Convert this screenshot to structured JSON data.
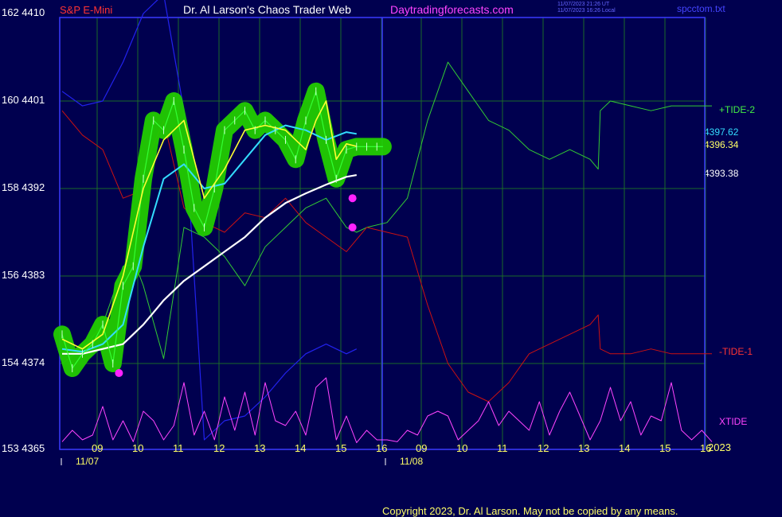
{
  "header": {
    "symbol": "S&P E-Mini",
    "title": "Dr. Al Larson's Chaos Trader Web",
    "site": "Daytradingforecasts.com",
    "file": "spcctom.txt",
    "timestamp_line1": "11/07/2023 21:26 UT",
    "timestamp_line2": "11/07/2023 16:26 Local"
  },
  "colors": {
    "background": "#00004f",
    "grid": "#1a6a2a",
    "border": "#3a3aff",
    "price_bars": "#33ff33",
    "glow": "#22cc00",
    "ma_fast": "#ffff33",
    "ma_mid": "#33ddff",
    "ma_slow": "#ffffff",
    "tide_plus": "#33cc33",
    "tide_minus": "#cc1111",
    "xtide": "#ff44ff",
    "blue_line": "#2222ee",
    "pivot": "#ff22ff"
  },
  "right_labels": {
    "tide_plus": "+TIDE-2",
    "ma_mid_value": "4397.62",
    "ma_fast_value": "4396.34",
    "ma_slow_value": "4393.38",
    "tide_minus": "-TIDE-1",
    "xtide": "XTIDE",
    "year": "2023"
  },
  "copyright": "Copyright 2023, Dr. Al Larson. May not be copied by any means.",
  "chart_data": {
    "type": "line",
    "title": "S&P E-Mini",
    "y_labels": [
      {
        "left": "162",
        "right": "4410",
        "price": 4410
      },
      {
        "left": "160",
        "right": "4401",
        "price": 4401
      },
      {
        "left": "158",
        "right": "4392",
        "price": 4392
      },
      {
        "left": "156",
        "right": "4383",
        "price": 4383
      },
      {
        "left": "154",
        "right": "4374",
        "price": 4374
      },
      {
        "left": "153",
        "right": "4365",
        "price": 4365
      }
    ],
    "ylim": [
      4365,
      4410
    ],
    "x_hour_ticks": [
      "09",
      "10",
      "11",
      "12",
      "13",
      "14",
      "15",
      "16",
      "09",
      "10",
      "11",
      "12",
      "13",
      "14",
      "15",
      "16"
    ],
    "dates": [
      "11/07",
      "11/08"
    ],
    "series": [
      {
        "name": "price",
        "x": [
          0,
          0.25,
          0.5,
          0.75,
          1,
          1.25,
          1.5,
          1.75,
          2,
          2.25,
          2.5,
          2.75,
          3,
          3.25,
          3.5,
          3.75,
          4,
          4.25,
          4.5,
          4.75,
          5,
          5.25,
          5.5,
          5.75,
          6,
          6.25,
          6.5,
          6.75,
          7,
          7.25,
          7.5,
          7.75,
          7.9
        ],
        "y": [
          4377,
          4373.5,
          4375,
          4376,
          4378,
          4374,
          4382,
          4384,
          4393,
          4399,
          4398,
          4401,
          4396,
          4390,
          4388,
          4392,
          4398,
          4399,
          4400,
          4398,
          4399,
          4398,
          4397,
          4395,
          4399,
          4402,
          4397,
          4393,
          4396,
          4396.3,
          4396.3,
          4396.3,
          4396.3
        ]
      },
      {
        "name": "ma_fast",
        "x": [
          0,
          0.5,
          1,
          1.5,
          2,
          2.5,
          3,
          3.5,
          4,
          4.5,
          5,
          5.5,
          6,
          6.25,
          6.5,
          6.75,
          7,
          7.25
        ],
        "y": [
          4376.5,
          4375.5,
          4377,
          4383,
          4392,
          4397,
          4399,
          4391,
          4394,
          4398,
          4398.5,
          4398,
          4396,
          4399,
          4401,
          4395,
          4396.6,
          4396.34
        ]
      },
      {
        "name": "ma_mid",
        "x": [
          0,
          0.5,
          1,
          1.5,
          2,
          2.5,
          3,
          3.5,
          4,
          4.5,
          5,
          5.5,
          6,
          6.5,
          7,
          7.25
        ],
        "y": [
          4375.5,
          4375.2,
          4376,
          4378,
          4386,
          4393,
          4394.5,
          4392,
          4392.5,
          4395,
          4397.5,
          4398.5,
          4398,
          4397,
          4397.8,
          4397.62
        ]
      },
      {
        "name": "ma_slow",
        "x": [
          0,
          0.5,
          1,
          1.5,
          2,
          2.5,
          3,
          3.5,
          4,
          4.5,
          5,
          5.5,
          6,
          6.5,
          7,
          7.25
        ],
        "y": [
          4375,
          4375,
          4375.5,
          4376,
          4378,
          4380.5,
          4382.5,
          4384,
          4385.5,
          4387,
          4389,
          4390.5,
          4391.5,
          4392.4,
          4393.2,
          4393.38
        ]
      },
      {
        "name": "+TIDE-2",
        "x": [
          0,
          0.5,
          1,
          1.5,
          1.8,
          2,
          2.5,
          3,
          3.5,
          4,
          4.5,
          5,
          5.5,
          6,
          6.5,
          7,
          7.25,
          7.5,
          8,
          8.5,
          9,
          9.5,
          10,
          10.5,
          11,
          11.5,
          12,
          12.5,
          13,
          13.2,
          13.25,
          13.5,
          14,
          14.5,
          15,
          15.5,
          16
        ],
        "y": [
          4374,
          4375.5,
          4378,
          4384,
          4384.2,
          4382,
          4374.5,
          4388,
          4387,
          4385,
          4382,
          4386,
          4388,
          4390,
          4391,
          4388,
          4387.5,
          4388,
          4388.5,
          4391,
          4399,
          4405,
          4402,
          4399,
          4398,
          4396,
          4395,
          4396,
          4395,
          4394,
          4400,
          4401,
          4400.5,
          4400,
          4400.5,
          4400.5,
          4400.5
        ]
      },
      {
        "name": "-TIDE-1",
        "x": [
          0,
          0.5,
          1,
          1.5,
          1.8,
          2,
          2.5,
          3,
          3.5,
          4,
          4.5,
          5,
          5.5,
          6,
          6.5,
          7,
          7.5,
          8,
          8.5,
          9,
          9.5,
          10,
          10.5,
          11,
          11.5,
          12,
          12.5,
          13,
          13.2,
          13.25,
          13.5,
          14,
          14.5,
          15,
          15.5,
          16
        ],
        "y": [
          4400,
          4397.5,
          4396,
          4391,
          4391.5,
          4394,
          4399,
          4390,
          4388.5,
          4387.5,
          4389.5,
          4389,
          4391,
          4388.5,
          4387,
          4385.5,
          4388,
          4387.5,
          4387,
          4380,
          4374,
          4371,
          4370,
          4372,
          4375,
          4376,
          4377,
          4378,
          4379,
          4375.5,
          4375,
          4375,
          4375.5,
          4375,
          4375,
          4375
        ]
      },
      {
        "name": "blue",
        "x": [
          0,
          0.5,
          1,
          1.5,
          2,
          2.5,
          3,
          3.5,
          4,
          4.5,
          5,
          5.5,
          6,
          6.5,
          7,
          7.25
        ],
        "y": [
          4402,
          4400.5,
          4401,
          4405,
          4410,
          4412,
          4400,
          4366,
          4368,
          4368.5,
          4370.5,
          4373,
          4375,
          4376,
          4375,
          4375.5
        ]
      },
      {
        "name": "XTIDE",
        "x": [
          0,
          0.25,
          0.5,
          0.75,
          1,
          1.25,
          1.5,
          1.75,
          2,
          2.25,
          2.5,
          2.75,
          3,
          3.25,
          3.5,
          3.75,
          4,
          4.25,
          4.5,
          4.75,
          5,
          5.25,
          5.5,
          5.75,
          6,
          6.25,
          6.5,
          6.75,
          7,
          7.25,
          7.5,
          7.75,
          8,
          8.25,
          8.5,
          8.75,
          9,
          9.25,
          9.5,
          9.75,
          10,
          10.25,
          10.5,
          10.75,
          11,
          11.25,
          11.5,
          11.75,
          12,
          12.25,
          12.5,
          12.75,
          13,
          13.25,
          13.5,
          13.75,
          14,
          14.25,
          14.5,
          14.75,
          15,
          15.25,
          15.5,
          15.75,
          16
        ],
        "y": [
          4365.8,
          4367,
          4366,
          4366.5,
          4369.5,
          4366,
          4368,
          4365.8,
          4369,
          4368,
          4366,
          4367.5,
          4372,
          4366.5,
          4369,
          4366,
          4370.5,
          4367,
          4371,
          4366.5,
          4372,
          4368,
          4367.5,
          4369,
          4366.5,
          4371.5,
          4372.5,
          4366,
          4368.5,
          4365.7,
          4367,
          4366,
          4366,
          4365.8,
          4367,
          4366.5,
          4368.5,
          4369,
          4368.5,
          4366,
          4367,
          4368,
          4370,
          4367.5,
          4369,
          4368,
          4367,
          4370,
          4366.5,
          4369,
          4371,
          4368.5,
          4366,
          4368,
          4371.5,
          4368,
          4370,
          4366.5,
          4368.5,
          4368,
          4372,
          4367,
          4366,
          4367,
          4365.8
        ]
      }
    ],
    "pivot_points": [
      {
        "x": 1.4,
        "y": 4373
      },
      {
        "x": 7.15,
        "y": 4388
      },
      {
        "x": 7.15,
        "y": 4391
      }
    ]
  }
}
